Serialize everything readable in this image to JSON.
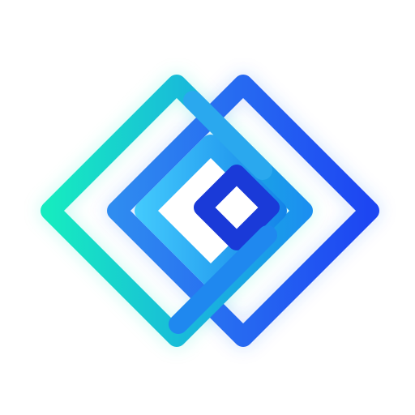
{
  "icon": {
    "name": "interlocking-diamonds-logo",
    "background_color": "#ffffff",
    "colors": {
      "left_diamond_start": "#16ebc0",
      "left_diamond_end": "#1b8ff0",
      "right_diamond_start": "#2f8cf0",
      "right_diamond_end": "#1d46f2",
      "inner_diamond_start": "#49d3ff",
      "inner_diamond_end": "#0e7be6",
      "core_diamond": "#1a3ad8"
    }
  }
}
